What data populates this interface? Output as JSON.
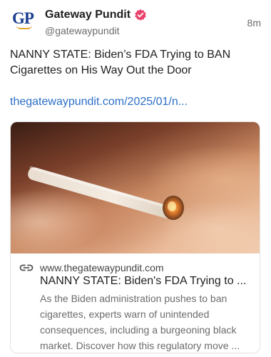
{
  "author": {
    "logo_text": "GP",
    "display_name": "Gateway Pundit",
    "handle": "@gatewaypundit",
    "verified_icon": "verified-badge-icon",
    "verified_color": "#e8446d"
  },
  "post": {
    "time": "8m",
    "text": "NANNY STATE: Biden’s FDA Trying to BAN Cigarettes on His Way Out the Door",
    "link_text": "thegatewaypundit.com/2025/01/n...",
    "link_color": "#2c6fc7"
  },
  "card": {
    "link_icon": "link-icon",
    "domain": "www.thegatewaypundit.com",
    "title": "NANNY STATE: Biden's FDA Trying to ...",
    "description": "As the Biden administration pushes to ban cigarettes, experts warn of unintended consequences, including a burgeoning black market. Discover how this regulatory move ..."
  }
}
